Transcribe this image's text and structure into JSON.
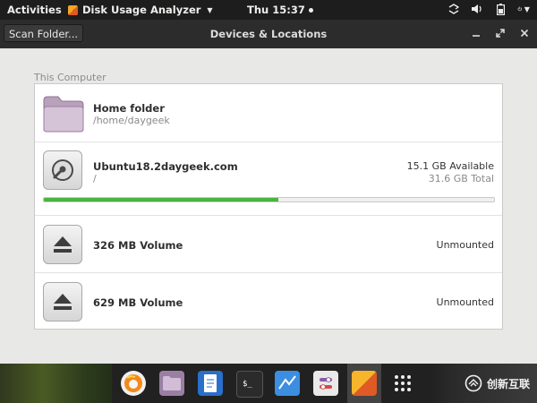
{
  "topbar": {
    "activities": "Activities",
    "app_name": "Disk Usage Analyzer",
    "clock": "Thu 15:37",
    "tray_icons": [
      "network-icon",
      "volume-icon",
      "battery-icon",
      "power-icon"
    ]
  },
  "headerbar": {
    "scan_button": "Scan Folder...",
    "title": "Devices & Locations"
  },
  "section": {
    "label": "This Computer"
  },
  "locations": [
    {
      "name": "Home folder",
      "path": "/home/daygeek",
      "icon": "folder-icon"
    },
    {
      "name": "Ubuntu18.2daygeek.com",
      "path": "/",
      "available": "15.1 GB Available",
      "total": "31.6 GB Total",
      "usage_fraction": 0.52,
      "icon": "hard-disk-icon"
    },
    {
      "name": "326 MB Volume",
      "status": "Unmounted",
      "icon": "eject-icon"
    },
    {
      "name": "629 MB Volume",
      "status": "Unmounted",
      "icon": "eject-icon"
    }
  ],
  "dock": {
    "items": [
      "firefox-icon",
      "files-icon",
      "text-editor-icon",
      "terminal-icon",
      "system-monitor-icon",
      "settings-icon",
      "disk-usage-analyzer-icon",
      "app-grid-icon"
    ],
    "active": "disk-usage-analyzer-icon"
  },
  "watermark": {
    "text": "创新互联"
  },
  "colors": {
    "usage_bar": "#4ab341",
    "topbar": "#1d1d1d",
    "headerbar": "#2c2c2c",
    "background": "#e8e8e7"
  }
}
